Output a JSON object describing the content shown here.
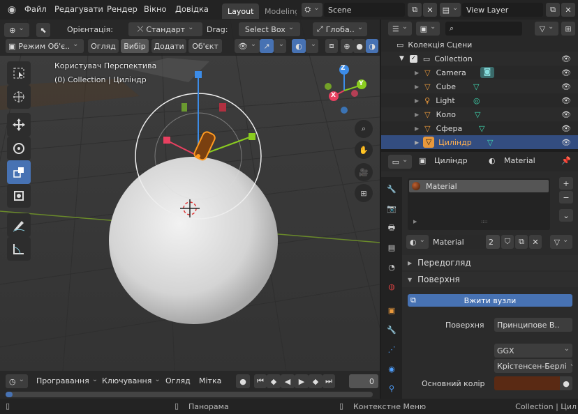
{
  "menu": {
    "items": [
      "Файл",
      "Редагувати",
      "Рендер",
      "Вікно",
      "Довідка"
    ],
    "tabs": [
      "Layout",
      "Modeling"
    ],
    "scene": "Scene",
    "view_layer": "View Layer"
  },
  "viewport": {
    "orientation_label": "Орієнтація:",
    "orientation_value": "Стандарт",
    "drag_label": "Drag:",
    "drag_value": "Select Box",
    "transform_value": "Глоба..",
    "mode": "Режим Об'є..",
    "view": "Огляд",
    "select": "Вибір",
    "add": "Додати",
    "object": "Об'єкт",
    "info_line1": "Користувач Перспектива",
    "info_line2": "(0) Collection | Циліндр",
    "gizmo": {
      "x": "X",
      "y": "Y",
      "z": "Z"
    }
  },
  "outliner": {
    "scene_collection": "Колекція Сцени",
    "collection": "Collection",
    "objects": [
      {
        "name": "Camera",
        "type": "camera"
      },
      {
        "name": "Cube",
        "type": "mesh"
      },
      {
        "name": "Light",
        "type": "light"
      },
      {
        "name": "Коло",
        "type": "mesh"
      },
      {
        "name": "Сфера",
        "type": "mesh"
      },
      {
        "name": "Циліндр",
        "type": "mesh",
        "selected": true
      }
    ]
  },
  "properties": {
    "object_name": "Циліндр",
    "tab": "Material",
    "slot": "Material",
    "material_name": "Material",
    "users": "2",
    "panel_preview": "Передогляд",
    "panel_surface": "Поверхня",
    "use_nodes": "Вжити вузли",
    "surface_label": "Поверхня",
    "surface_value": "Принципове В..",
    "distribution": "GGX",
    "subsurface": "Крістенсен-Берлі",
    "base_color_label": "Основний колір",
    "base_color": "#5a2a14"
  },
  "timeline": {
    "playback": "Програвання",
    "keying": "Ключування",
    "view": "Огляд",
    "markers": "Мітка",
    "frame": "0"
  },
  "status": {
    "pan": "Панорама",
    "context": "Контекстне Меню",
    "right": "Collection | Цил"
  }
}
